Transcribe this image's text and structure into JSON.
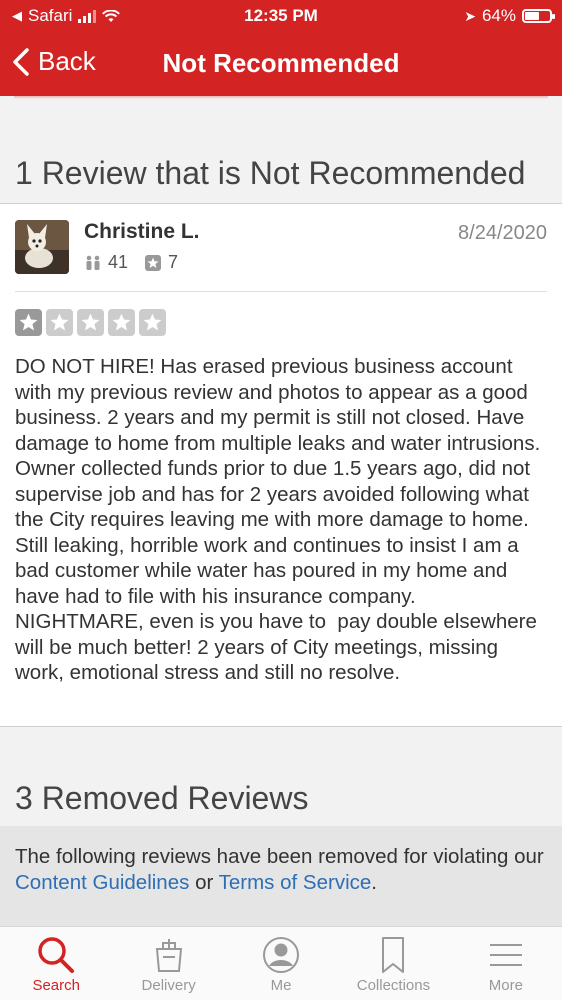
{
  "status_bar": {
    "back_app": "Safari",
    "time": "12:35 PM",
    "battery": "64%",
    "battery_level": 0.64
  },
  "nav": {
    "back_label": "Back",
    "title": "Not Recommended"
  },
  "not_recommended": {
    "heading": "1 Review that is Not Recommended",
    "review": {
      "user": "Christine L.",
      "friends": "41",
      "reviews": "7",
      "date": "8/24/2020",
      "rating": 1,
      "rating_max": 5,
      "text": "DO NOT HIRE! Has erased previous business account with my previous review and photos to appear as a good business. 2 years and my permit is still not closed. Have damage to home from multiple leaks and water intrusions. Owner collected funds prior to due 1.5 years ago, did not supervise job and has for 2 years avoided following what the City requires leaving me with more damage to home. Still leaking, horrible work and continues to insist I am a bad customer while water has poured in my home and have had to file with his insurance company. NIGHTMARE, even is you have to  pay double elsewhere will be much better! 2 years of City meetings, missing work, emotional stress and still no resolve."
    }
  },
  "removed": {
    "heading": "3 Removed Reviews",
    "text_before": "The following reviews have been removed for violating our ",
    "link1": "Content Guidelines",
    "text_mid": " or ",
    "link2": "Terms of Service",
    "text_after": "."
  },
  "tabs": [
    {
      "label": "Search",
      "icon": "search-icon",
      "active": true
    },
    {
      "label": "Delivery",
      "icon": "delivery-bag-icon",
      "active": false
    },
    {
      "label": "Me",
      "icon": "user-icon",
      "active": false
    },
    {
      "label": "Collections",
      "icon": "bookmark-icon",
      "active": false
    },
    {
      "label": "More",
      "icon": "menu-icon",
      "active": false
    }
  ],
  "colors": {
    "brand": "#d32323",
    "link": "#2d6fb5",
    "tab_inactive": "#999999"
  }
}
